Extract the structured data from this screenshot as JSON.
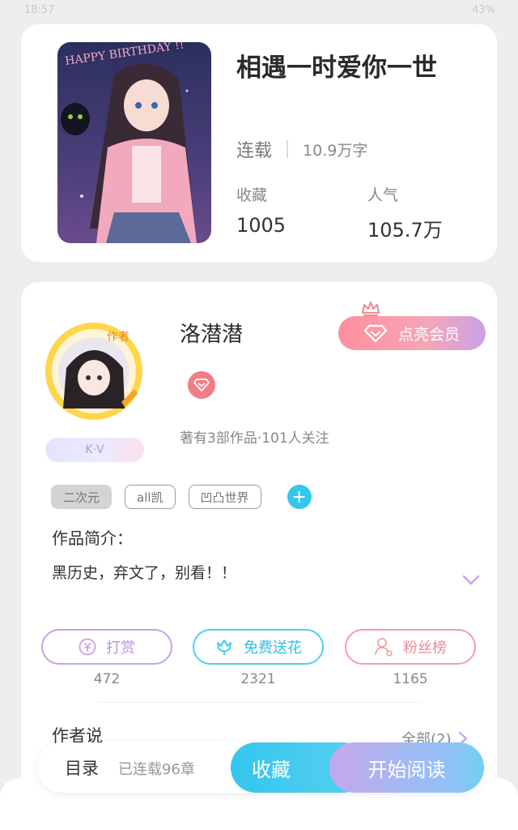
{
  "statusbar": {
    "time": "18:57",
    "battery": "43%"
  },
  "book": {
    "title": "相遇一时爱你一世",
    "status": "连载",
    "word_count": "10.9万字",
    "stats": [
      {
        "label": "收藏",
        "value": "1005"
      },
      {
        "label": "人气",
        "value": "105.7万"
      }
    ],
    "cover_text": "HAPPY BIRTHDAY !!"
  },
  "author": {
    "name": "洛潜潜",
    "avatar_badge": "作者",
    "kv_label": "K·V",
    "meta": "著有3部作品·101人关注",
    "vip_button": "点亮会员"
  },
  "tags": [
    "二次元",
    "all凯",
    "凹凸世界"
  ],
  "intro": {
    "title": "作品简介：",
    "text": "黑历史，弃文了，别看！！"
  },
  "actions": [
    {
      "label": "打赏",
      "count": "472"
    },
    {
      "label": "免费送花",
      "count": "2321"
    },
    {
      "label": "粉丝榜",
      "count": "1165"
    }
  ],
  "author_says": {
    "title": "作者说",
    "all_link": "全部(2)"
  },
  "bottom_bar": {
    "toc": "目录",
    "chapters": "已连载96章",
    "collect": "收藏",
    "read": "开始阅读"
  },
  "colors": {
    "accent_blue": "#35c6ee",
    "accent_pink": "#f07d86",
    "accent_purple": "#c6a2e6"
  }
}
